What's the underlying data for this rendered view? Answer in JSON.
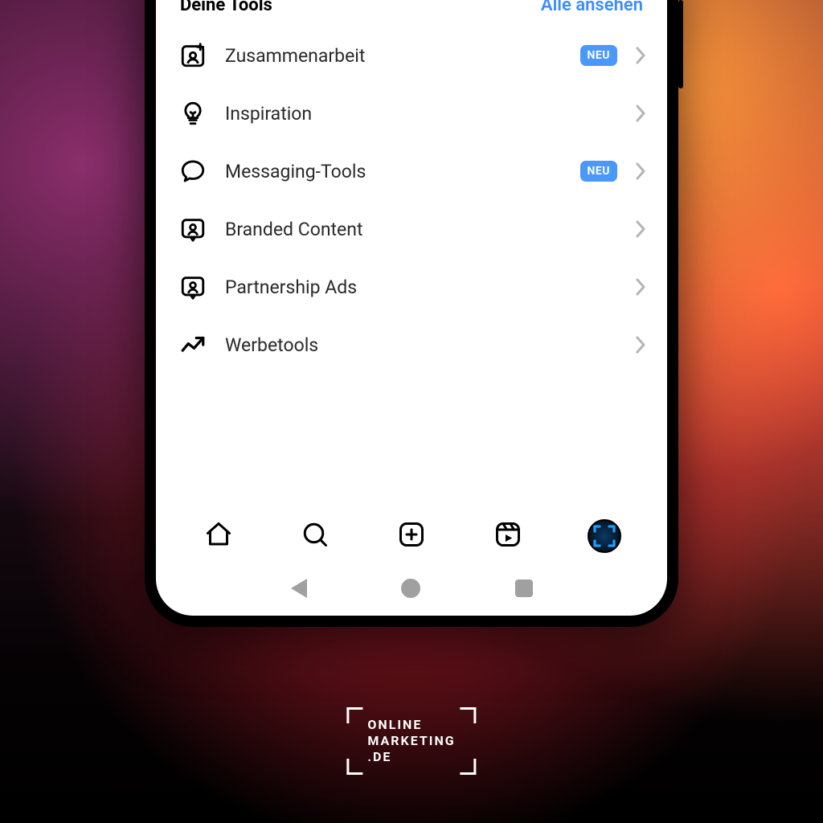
{
  "section": {
    "title": "Deine Tools",
    "seeAll": "Alle ansehen"
  },
  "badgeText": "NEU",
  "tools": [
    {
      "label": "Zusammenarbeit",
      "icon": "collab",
      "badge": true
    },
    {
      "label": "Inspiration",
      "icon": "bulb",
      "badge": false
    },
    {
      "label": "Messaging-Tools",
      "icon": "chat",
      "badge": true
    },
    {
      "label": "Branded Content",
      "icon": "branded",
      "badge": false
    },
    {
      "label": "Partnership Ads",
      "icon": "branded",
      "badge": false
    },
    {
      "label": "Werbetools",
      "icon": "trend",
      "badge": false
    }
  ],
  "brand": {
    "line1": "ONLINE",
    "line2": "MARKETING",
    "line3": ".DE"
  },
  "colors": {
    "link": "#3a8cff",
    "badge": "#4a98f7"
  }
}
